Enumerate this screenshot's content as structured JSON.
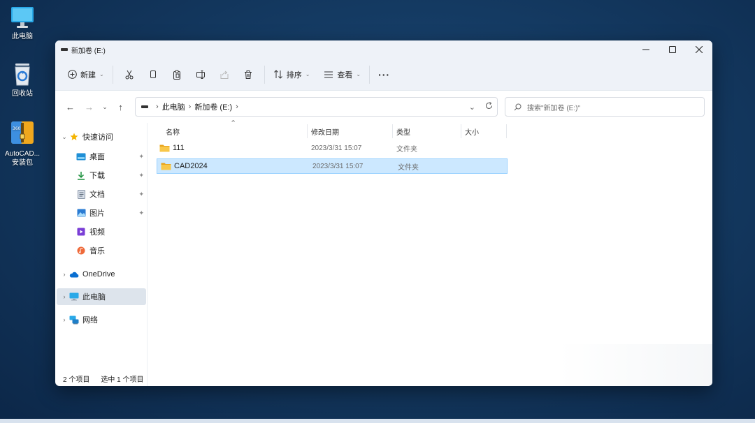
{
  "desktop": {
    "icons": [
      {
        "label": "此电脑",
        "icon": "monitor-icon"
      },
      {
        "label": "回收站",
        "icon": "recycle-bin-icon"
      },
      {
        "label_line1": "AutoCAD...",
        "label_line2": "安装包",
        "icon": "360zip-archive-icon"
      }
    ]
  },
  "window": {
    "title": "新加卷 (E:)",
    "controls": {
      "minimize": "minimize-icon",
      "maximize": "maximize-icon",
      "close": "close-icon"
    }
  },
  "commandbar": {
    "new_label": "新建",
    "sort_label": "排序",
    "view_label": "查看",
    "more_label": "···"
  },
  "address": {
    "crumbs": [
      "此电脑",
      "新加卷 (E:)"
    ],
    "search_placeholder": "搜索\"新加卷 (E:)\""
  },
  "navpane": {
    "quick_access": "快速访问",
    "quick_items": [
      "桌面",
      "下载",
      "文档",
      "图片",
      "视频",
      "音乐"
    ],
    "onedrive": "OneDrive",
    "this_pc": "此电脑",
    "network": "网络"
  },
  "columns": {
    "name": "名称",
    "date": "修改日期",
    "type": "类型",
    "size": "大小"
  },
  "files": [
    {
      "name": "111",
      "date": "2023/3/31 15:07",
      "type": "文件夹",
      "selected": false
    },
    {
      "name": "CAD2024",
      "date": "2023/3/31 15:07",
      "type": "文件夹",
      "selected": true
    }
  ],
  "status": {
    "count": "2 个项目",
    "selected": "选中 1 个项目"
  },
  "colors": {
    "accent": "#0067c0",
    "selection": "#cce8ff",
    "folder": "#f8c74a"
  }
}
